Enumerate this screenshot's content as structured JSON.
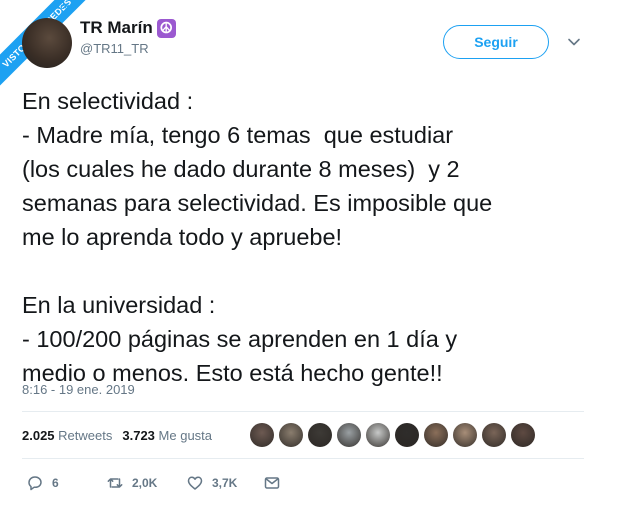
{
  "watermark": {
    "text": "VISTOENLASREDES",
    "suffix": ".com"
  },
  "user": {
    "name": "TR Marín",
    "emoji": "☮",
    "handle": "@TR11_TR"
  },
  "follow_label": "Seguir",
  "tweet": {
    "text": "En selectividad :\n- Madre mía, tengo 6 temas  que estudiar\n(los cuales he dado durante 8 meses)  y 2\nsemanas para selectividad. Es imposible que\nme lo aprenda todo y apruebe!\n\nEn la universidad :\n- 100/200 páginas se aprenden en 1 día y\nmedio o menos. Esto está hecho gente!!",
    "timestamp": "8:16 - 19 ene. 2019"
  },
  "stats": {
    "retweets_count": "2.025",
    "retweets_label": "Retweets",
    "likes_count": "3.723",
    "likes_label": "Me gusta"
  },
  "actions": {
    "replies": "6",
    "retweets": "2,0K",
    "likes": "3,7K"
  },
  "colors": {
    "accent": "#1da1f2",
    "text": "#14171a",
    "muted": "#657786",
    "likers": [
      "#6d5a52",
      "#8a7d6e",
      "#3d3a36",
      "#9aa0a3",
      "#c7c9c8",
      "#2f2d2b",
      "#8b6f5a",
      "#a88e78",
      "#7a6558",
      "#5e4a42"
    ]
  }
}
